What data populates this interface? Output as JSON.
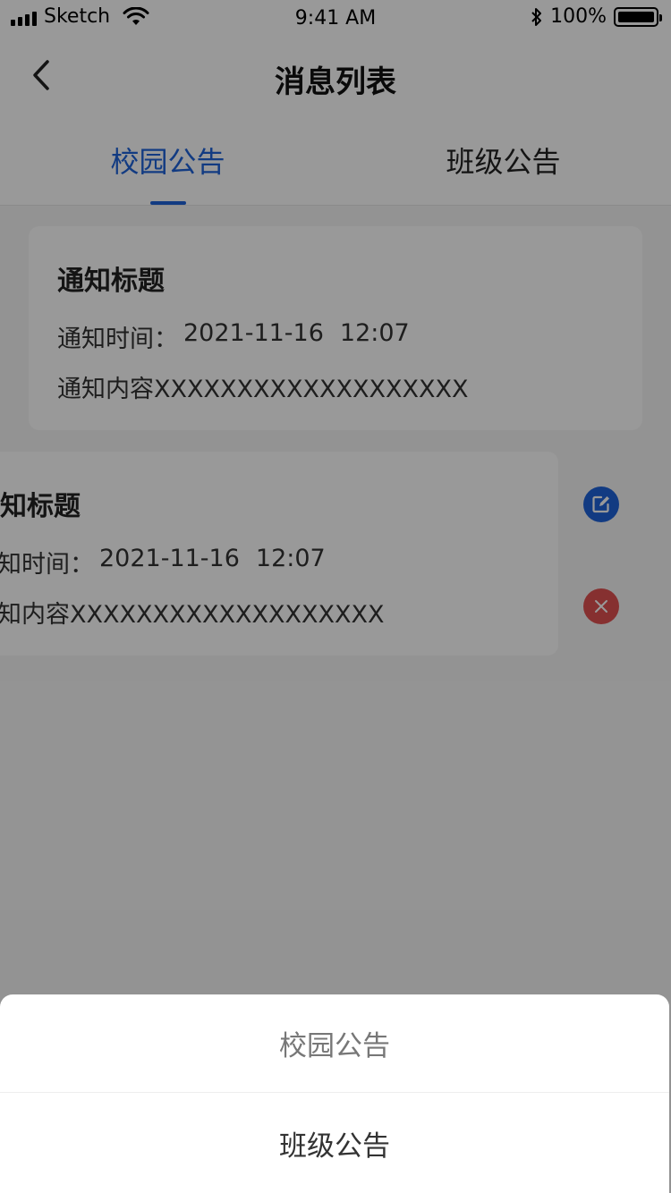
{
  "status_bar": {
    "carrier": "Sketch",
    "time": "9:41 AM",
    "battery": "100%",
    "signal_icon": "signal-bars-icon",
    "wifi_icon": "wifi-icon",
    "bluetooth_icon": "bluetooth-icon",
    "battery_icon": "battery-icon"
  },
  "nav": {
    "title": "消息列表",
    "back_icon": "chevron-left-icon"
  },
  "tabs": [
    {
      "label": "校园公告",
      "active": true
    },
    {
      "label": "班级公告",
      "active": false
    }
  ],
  "cards": [
    {
      "title": "通知标题",
      "time_label": "通知时间：",
      "date": "2021-11-16",
      "time": "12:07",
      "content": "通知内容XXXXXXXXXXXXXXXXXXX"
    },
    {
      "title": "通知标题",
      "time_label": "通知时间：",
      "date": "2021-11-16",
      "time": "12:07",
      "content": "通知内容XXXXXXXXXXXXXXXXXXX",
      "actions": {
        "edit_icon": "edit-icon",
        "delete_icon": "close-icon"
      }
    }
  ],
  "action_sheet": {
    "items": [
      {
        "label": "校园公告"
      },
      {
        "label": "班级公告"
      }
    ]
  },
  "colors": {
    "accent": "#1f63d9",
    "danger": "#e05050",
    "overlay": "rgba(0,0,0,0.4)"
  }
}
